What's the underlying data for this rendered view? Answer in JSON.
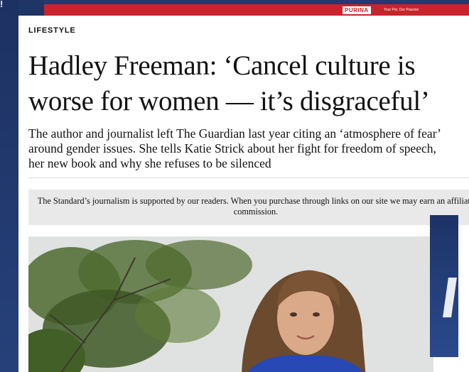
{
  "background": {
    "glyph": "!"
  },
  "ad_banner": {
    "brand": "PURINA",
    "tagline": "Your Pet, Our Passion"
  },
  "article": {
    "section": "LIFESTYLE",
    "headline": "Hadley Freeman: ‘Cancel culture is worse for women — it’s disgraceful’",
    "standfirst": "The author and journalist left The Guardian last year citing an ‘atmosphere of fear’ around gender issues. She tells Katie Strick about her fight for freedom of speech, her new book and why she refuses to be silenced",
    "disclaimer": "The Standard’s journalism is supported by our readers. When you purchase through links on our site we may earn an affiliate commission.",
    "hero_image": "photo-of-woman-with-tree"
  },
  "colors": {
    "page_background": "#1e3566",
    "ad_red": "#c7252b",
    "disclaimer_bg": "#e9e9e9",
    "text": "#121212"
  }
}
